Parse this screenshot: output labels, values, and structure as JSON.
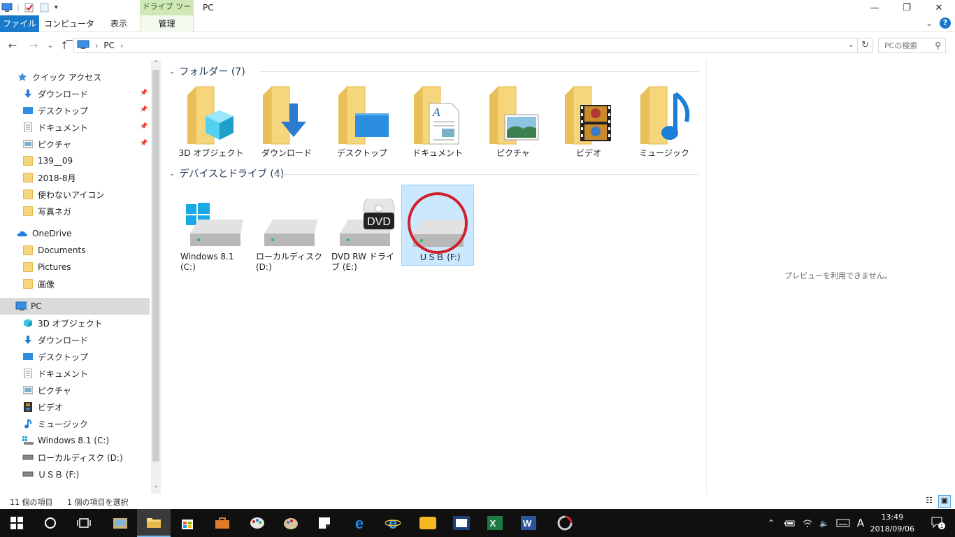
{
  "window": {
    "title": "PC",
    "context_tab_group": "ドライブ ツール",
    "minimize": "—",
    "restore": "❐",
    "close": "✕"
  },
  "ribbon": {
    "tabs": [
      {
        "label": "ファイル"
      },
      {
        "label": "コンピューター"
      },
      {
        "label": "表示"
      },
      {
        "label": "管理"
      }
    ],
    "collapse": "⌄",
    "help": "?"
  },
  "address": {
    "back": "←",
    "forward": "→",
    "recent": "⌄",
    "up": "↑",
    "crumb_sep": "›",
    "crumb": "PC",
    "dropdown": "⌄",
    "refresh": "↻",
    "search_placeholder": "PCの検索",
    "search_icon": "⚲"
  },
  "sidebar": {
    "items": [
      {
        "label": "クイック アクセス",
        "icon": "star-icon"
      },
      {
        "label": "ダウンロード",
        "icon": "download-icon",
        "pinned": true
      },
      {
        "label": "デスクトップ",
        "icon": "desktop-icon",
        "pinned": true
      },
      {
        "label": "ドキュメント",
        "icon": "document-icon",
        "pinned": true
      },
      {
        "label": "ピクチャ",
        "icon": "pictures-icon",
        "pinned": true
      },
      {
        "label": "139__09",
        "icon": "folder-icon"
      },
      {
        "label": "2018-8月",
        "icon": "folder-icon"
      },
      {
        "label": "使わないアイコン",
        "icon": "folder-icon"
      },
      {
        "label": "写真ネガ",
        "icon": "folder-icon"
      },
      {
        "label": "OneDrive",
        "icon": "cloud-icon"
      },
      {
        "label": "Documents",
        "icon": "folder-icon"
      },
      {
        "label": "Pictures",
        "icon": "folder-icon"
      },
      {
        "label": "画像",
        "icon": "folder-icon"
      },
      {
        "label": "PC",
        "icon": "computer-icon",
        "selected": true
      },
      {
        "label": "3D オブジェクト",
        "icon": "cube-icon"
      },
      {
        "label": "ダウンロード",
        "icon": "download-icon"
      },
      {
        "label": "デスクトップ",
        "icon": "desktop-icon"
      },
      {
        "label": "ドキュメント",
        "icon": "document-icon"
      },
      {
        "label": "ピクチャ",
        "icon": "pictures-icon"
      },
      {
        "label": "ビデオ",
        "icon": "video-icon"
      },
      {
        "label": "ミュージック",
        "icon": "music-icon"
      },
      {
        "label": "Windows 8.1 (C:)",
        "icon": "windows-drive-icon"
      },
      {
        "label": "ローカルディスク (D:)",
        "icon": "drive-icon"
      },
      {
        "label": "ＵＳＢ (F:)",
        "icon": "drive-icon"
      }
    ],
    "pin_glyph": "📌",
    "scroll_up": "⌃",
    "scroll_down": "⌄"
  },
  "content": {
    "folders_group": "フォルダー (7)",
    "devices_group": "デバイスとドライブ (4)",
    "group_chevron": "⌄",
    "folders": [
      {
        "label": "3D オブジェクト",
        "overlay": "cube-icon"
      },
      {
        "label": "ダウンロード",
        "overlay": "download-icon"
      },
      {
        "label": "デスクトップ",
        "overlay": "desktop-icon"
      },
      {
        "label": "ドキュメント",
        "overlay": "document-icon"
      },
      {
        "label": "ピクチャ",
        "overlay": "pictures-icon"
      },
      {
        "label": "ビデオ",
        "overlay": "video-icon"
      },
      {
        "label": "ミュージック",
        "overlay": "music-icon"
      }
    ],
    "drives": [
      {
        "label": "Windows 8.1 (C:)",
        "icon": "windows-drive-icon"
      },
      {
        "label": "ローカルディスク (D:)",
        "icon": "drive-icon"
      },
      {
        "label": "DVD RW ドライブ (E:)",
        "icon": "dvd-drive-icon",
        "badge": "DVD"
      },
      {
        "label": "ＵＳＢ (F:)",
        "icon": "drive-icon",
        "selected": true,
        "highlight": "red-circle"
      }
    ],
    "preview_text": "プレビューを利用できません。"
  },
  "status": {
    "item_count": "11 個の項目",
    "selection": "1 個の項目を選択",
    "details_view": "☷",
    "large_icons_view": "▣"
  },
  "taskbar": {
    "apps": [
      "start-icon",
      "cortana-icon",
      "task-view-icon",
      "app-icon",
      "file-explorer-icon",
      "store-icon",
      "toolbox-icon",
      "paint-icon",
      "palette-icon",
      "sticky-notes-icon",
      "edge-icon",
      "ie-icon",
      "app-yellow-icon",
      "app-blue-icon",
      "excel-icon",
      "word-icon",
      "app-gray-icon"
    ],
    "tray_up": "⌃",
    "ime": "A",
    "volume": "🔈",
    "time": "13:49",
    "date": "2018/09/06",
    "notification_count": "1"
  },
  "colors": {
    "accent": "#1979ca",
    "selection_bg": "#cce8ff",
    "folder": "#f6d67a",
    "highlight_circle": "#d0202a",
    "taskbar": "#101010"
  }
}
